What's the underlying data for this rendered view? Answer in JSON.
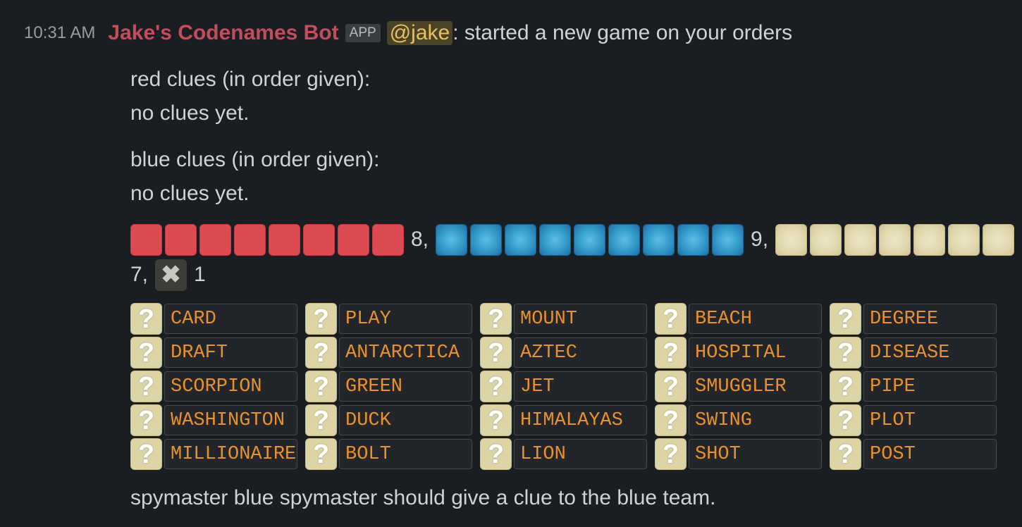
{
  "message": {
    "time": "10:31 AM",
    "sender": "Jake's Codenames Bot",
    "app_badge": "APP",
    "mention": "@jake",
    "header_text": ": started a new game on your orders"
  },
  "clues": {
    "red_heading": "red clues (in order given):",
    "red_value": "no clues yet.",
    "blue_heading": "blue clues (in order given):",
    "blue_value": "no clues yet."
  },
  "legend": {
    "red_count": "8,",
    "blue_count": "9,",
    "neutral_count": "7,",
    "assassin_count": "1",
    "assassin_glyph": "✖",
    "colors": {
      "red": "#de4a52",
      "blue": "#3299c8",
      "neutral": "#e0d7ad",
      "assassin": "#3d3e3a"
    }
  },
  "board": {
    "hidden_glyph": "?",
    "word_color": "#e8912d",
    "rows": [
      [
        "CARD",
        "PLAY",
        "MOUNT",
        "BEACH",
        "DEGREE"
      ],
      [
        "DRAFT",
        "ANTARCTICA",
        "AZTEC",
        "HOSPITAL",
        "DISEASE"
      ],
      [
        "SCORPION",
        "GREEN",
        "JET",
        "SMUGGLER",
        "PIPE"
      ],
      [
        "WASHINGTON",
        "DUCK",
        "HIMALAYAS",
        "SWING",
        "PLOT"
      ],
      [
        "MILLIONAIRE",
        "BOLT",
        "LION",
        "SHOT",
        "POST"
      ]
    ]
  },
  "footer": "spymaster blue spymaster should give a clue to the blue team."
}
